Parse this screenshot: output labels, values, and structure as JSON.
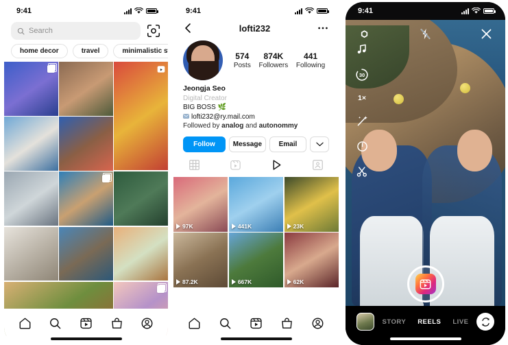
{
  "status_bar": {
    "time": "9:41",
    "signal_icon": "cellular-bars-icon",
    "wifi_icon": "wifi-icon",
    "battery_icon": "battery-icon"
  },
  "phone1": {
    "name": "instagram-explore-screen",
    "search": {
      "placeholder": "Search",
      "icon": "search-icon",
      "scan_icon": "scan-code-icon"
    },
    "tags": [
      "home decor",
      "travel",
      "minimalistic sty"
    ],
    "grid": [
      {
        "id": "cell-1",
        "span": "one",
        "badge": "multi-photo-icon",
        "colors": [
          "#3c5ec9",
          "#7b6fd2",
          "#2a3f8f"
        ]
      },
      {
        "id": "cell-2",
        "span": "one",
        "badge": "",
        "colors": [
          "#8a6a52",
          "#c89a74",
          "#4d5a3a"
        ]
      },
      {
        "id": "cell-3",
        "span": "tall",
        "badge": "reels-icon",
        "colors": [
          "#d94a3d",
          "#e8b43a",
          "#c23f33"
        ]
      },
      {
        "id": "cell-4",
        "span": "one",
        "badge": "",
        "colors": [
          "#6fa8d6",
          "#e4e1db",
          "#3c6fa0"
        ]
      },
      {
        "id": "cell-5",
        "span": "one",
        "badge": "",
        "colors": [
          "#2f5fb0",
          "#8a5f45",
          "#d8654e"
        ]
      },
      {
        "id": "cell-6",
        "span": "one",
        "badge": "",
        "colors": [
          "#9aa7b2",
          "#cfd6d9",
          "#6a7480"
        ]
      },
      {
        "id": "cell-7",
        "span": "one",
        "badge": "multi-photo-icon",
        "colors": [
          "#2f7fb8",
          "#c9a071",
          "#1f5a86"
        ]
      },
      {
        "id": "cell-8",
        "span": "one",
        "badge": "",
        "colors": [
          "#2e5b3e",
          "#4f7a58",
          "#24402e"
        ]
      },
      {
        "id": "cell-9",
        "span": "one",
        "badge": "",
        "colors": [
          "#e7e3dc",
          "#b9b2a6",
          "#8f8677"
        ]
      },
      {
        "id": "cell-10",
        "span": "one",
        "badge": "",
        "colors": [
          "#4a86b8",
          "#7a6a55",
          "#2c5878"
        ]
      },
      {
        "id": "cell-11",
        "span": "one",
        "badge": "",
        "colors": [
          "#e8b07a",
          "#d4e0c2",
          "#a9743f"
        ]
      },
      {
        "id": "cell-12",
        "span": "wide",
        "badge": "",
        "colors": [
          "#d8b074",
          "#6e8e3e",
          "#9d5e33"
        ]
      },
      {
        "id": "cell-13",
        "span": "one",
        "badge": "multi-photo-icon",
        "colors": [
          "#f3c7bd",
          "#b592c9",
          "#e8a79a"
        ]
      }
    ],
    "tabbar": [
      "home-icon",
      "search-icon",
      "reels-icon",
      "shop-icon",
      "profile-icon"
    ]
  },
  "phone2": {
    "name": "instagram-profile-screen",
    "nav": {
      "back_icon": "chevron-left-icon",
      "title": "lofti232",
      "menu_icon": "more-options-icon"
    },
    "avatar": "profile-avatar",
    "stats": [
      {
        "value": "574",
        "label": "Posts"
      },
      {
        "value": "874K",
        "label": "Followers"
      },
      {
        "value": "441",
        "label": "Following"
      }
    ],
    "bio": {
      "display_name": "Jeongja Seo",
      "category": "Digital Creator",
      "line1": "BIG BOSS 🌿",
      "email_icon": "email-icon",
      "email": "lofti232@ry.mail.com",
      "followed_prefix": "Followed by ",
      "followed_a": "analog",
      "followed_mid": " and ",
      "followed_b": "autonommy"
    },
    "buttons": {
      "follow": "Follow",
      "message": "Message",
      "email": "Email",
      "more_icon": "chevron-down-icon"
    },
    "tabs": [
      "grid-tab-icon",
      "reels-tab-icon",
      "video-tab-icon",
      "tagged-tab-icon"
    ],
    "active_tab_index": 2,
    "reels": [
      {
        "views": "97K",
        "colors": [
          "#d96a7a",
          "#e3b49b",
          "#8a4a55"
        ]
      },
      {
        "views": "441K",
        "colors": [
          "#5aa8dc",
          "#9fd0ee",
          "#3c7fb5"
        ]
      },
      {
        "views": "23K",
        "colors": [
          "#3c4a2a",
          "#e0c04a",
          "#6d7a36"
        ]
      },
      {
        "views": "87.2K",
        "colors": [
          "#cbb89c",
          "#8a7254",
          "#5d4a36"
        ]
      },
      {
        "views": "667K",
        "colors": [
          "#66a5d8",
          "#4d7a3c",
          "#2f5a2a"
        ]
      },
      {
        "views": "62K",
        "colors": [
          "#8a3a3f",
          "#d8a98d",
          "#5a2428"
        ]
      }
    ],
    "tabbar": [
      "home-icon",
      "search-icon",
      "reels-icon",
      "shop-icon",
      "profile-icon"
    ]
  },
  "phone3": {
    "name": "instagram-reels-camera-screen",
    "top": {
      "settings_icon": "aperture-settings-icon",
      "flash_icon": "flash-off-icon",
      "close_icon": "close-icon"
    },
    "left_tools": [
      {
        "icon": "music-note-icon",
        "label": ""
      },
      {
        "icon": "timer-icon",
        "label": "30"
      },
      {
        "icon": "speed-icon",
        "label": "1×"
      },
      {
        "icon": "effects-wand-icon",
        "label": ""
      },
      {
        "icon": "align-timer-icon",
        "label": ""
      },
      {
        "icon": "scissors-trim-icon",
        "label": ""
      }
    ],
    "record_button": {
      "icon": "reels-clapper-icon"
    },
    "bottom": {
      "gallery_icon": "gallery-thumbnail",
      "modes": [
        "STORY",
        "REELS",
        "LIVE"
      ],
      "active_mode": "REELS",
      "flip_icon": "camera-flip-icon"
    }
  },
  "theme": {
    "accent_blue": "#0095f6",
    "chip_border": "#e2e2e2",
    "search_bg": "#efefef",
    "muted": "#8e8e8e"
  }
}
